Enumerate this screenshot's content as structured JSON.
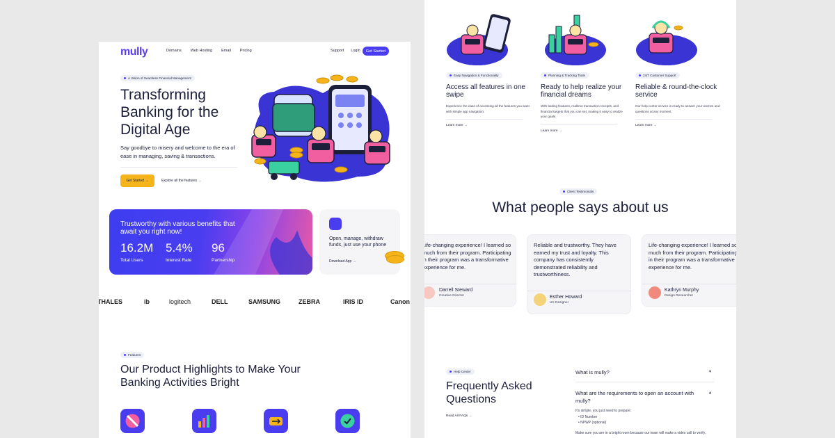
{
  "left": {
    "nav": {
      "logo": "mully",
      "links": [
        "Domains",
        "Web Hosting",
        "Email",
        "Pricing"
      ],
      "support": "Support",
      "login": "Login",
      "cta": "Get Started"
    },
    "hero": {
      "pill": "A Vision of Seamless Financial Management",
      "title": "Transforming Banking for the Digital Age",
      "subtitle": "Say goodbye to misery and welcome to the era of ease in managing, saving & transactions.",
      "cta_primary": "Get Started →",
      "cta_secondary": "Explore all the features →"
    },
    "stats": {
      "title": "Trustworthy with various benefits that await you right now!",
      "items": [
        {
          "value": "16.2M",
          "label": "Total Users"
        },
        {
          "value": "5.4%",
          "label": "Interest Rate"
        },
        {
          "value": "96",
          "label": "Partnership"
        }
      ]
    },
    "app_card": {
      "text": "Open, manage, withdraw funds, just use your phone",
      "link": "Download App →"
    },
    "logos": [
      "THALES",
      "ib",
      "logitech",
      "DELL",
      "SAMSUNG",
      "ZEBRA",
      "IRIS ID",
      "Canon"
    ],
    "features": {
      "pill": "Features",
      "title": "Our Product Highlights to Make Your Banking Activities Bright"
    }
  },
  "right": {
    "columns": [
      {
        "pill": "Easy Navigation & Functionality",
        "title": "Access all features in one swipe",
        "desc": "Experience the ease of accessing all the features you want with simple app navigation.",
        "link": "Learn more →"
      },
      {
        "pill": "Planning & Tracking Tools",
        "title": "Ready to help realize your financial dreams",
        "desc": "With baking features, realtime transaction receipts, and financial targets that you can set, making it easy to realize your goals.",
        "link": "Learn more →"
      },
      {
        "pill": "24/7 Customer Support",
        "title": "Reliable & round-the-clock service",
        "desc": "Our help center service is ready to answer your worries and questions at any moment.",
        "link": "Learn more →"
      }
    ],
    "testimonials": {
      "pill": "Client Testimonials",
      "title": "What people says about us",
      "cards": [
        {
          "quote": "Life-changing experience! I learned so much from their program. Participating in their program was a transformative experience for me.",
          "name": "Darrell Steward",
          "role": "Creative Director"
        },
        {
          "quote": "Reliable and trustworthy. They have earned my trust and loyalty. This company has consistently demonstrated reliability and trustworthiness.",
          "name": "Esther Howard",
          "role": "UX Designer"
        },
        {
          "quote": "Life-changing experience! I learned so much from their program. Participating in their program was a transformative experience for me.",
          "name": "Kathryn Murphy",
          "role": "Design Researcher"
        }
      ]
    },
    "faq": {
      "pill": "Help Center",
      "title": "Frequently Asked Questions",
      "link": "Read All FAQs →",
      "questions": [
        "What is mully?",
        "What are the requirements to open an account with mully?"
      ],
      "answer_intro": "It's simple, you just need to prepare:",
      "answer_items": [
        "ID Number",
        "NPWP (optional)"
      ],
      "answer_more": "Make sure you are in a bright room because our team will make a video call to verify."
    }
  },
  "colors": {
    "brand": "#4a3df0",
    "accent_yellow": "#f4b41a",
    "pink": "#e75aa6",
    "text": "#1c1f3a"
  }
}
